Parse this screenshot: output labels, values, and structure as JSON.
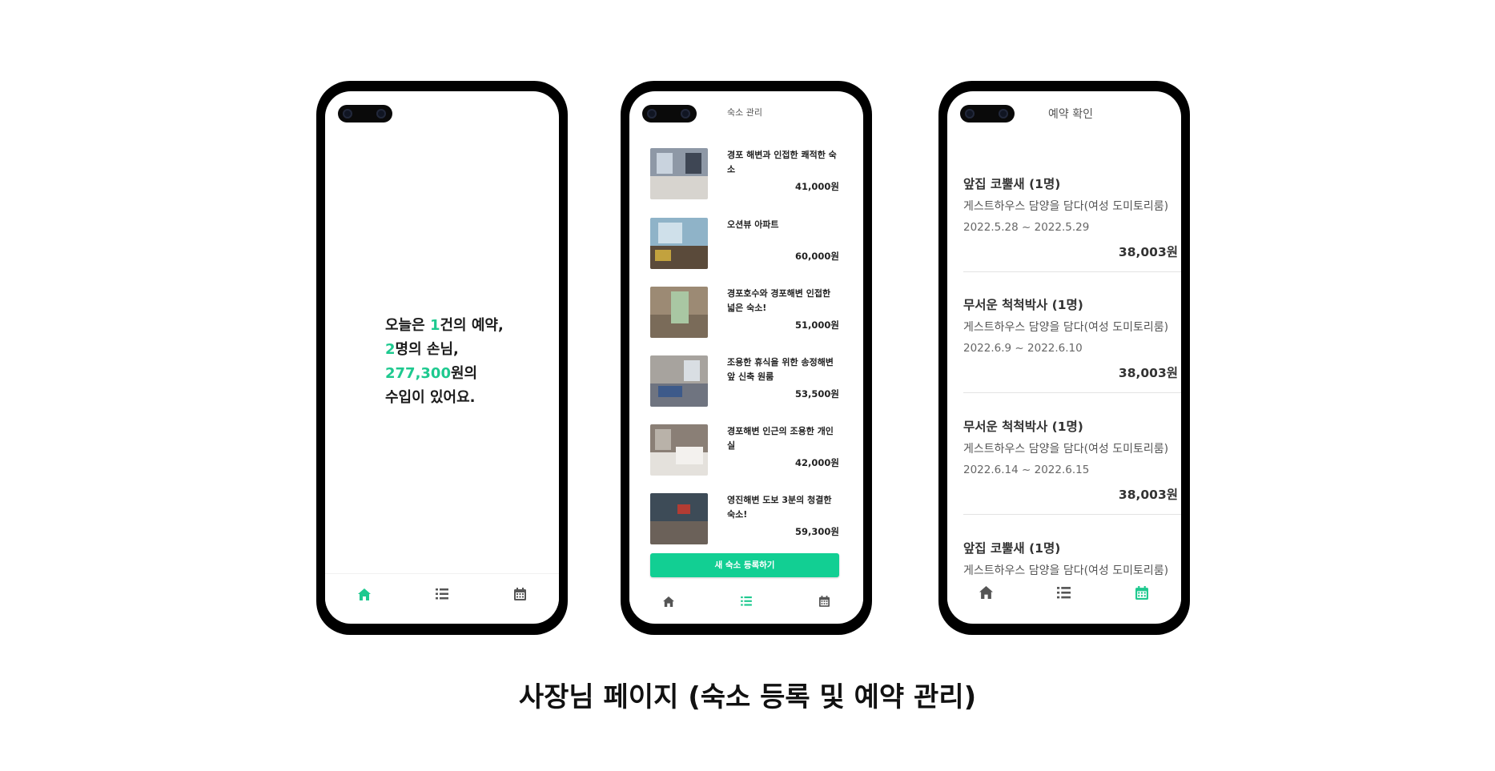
{
  "caption": "사장님 페이지 (숙소 등록 및 예약 관리)",
  "colors": {
    "accent": "#1ec98f",
    "button": "#12cf93",
    "nav_inactive": "#555555"
  },
  "home_screen": {
    "line1_prefix": "오늘은 ",
    "bookings_count": "1",
    "line1_suffix": "건의 예약,",
    "guests_count": "2",
    "line2_suffix": "명의 손님,",
    "income": "277,300",
    "line3_suffix": "원의",
    "line4": "수입이 있어요.",
    "nav": {
      "active": "home",
      "icons": [
        "home-icon",
        "list-icon",
        "calendar-icon"
      ]
    }
  },
  "listings_screen": {
    "title": "숙소 관리",
    "listings": [
      {
        "name": "경포 해변과 인접한 쾌적한 숙소",
        "price": "41,000원"
      },
      {
        "name": "오션뷰 아파트",
        "price": "60,000원"
      },
      {
        "name": "경포호수와 경포해변 인접한 넓은 숙소!",
        "price": "51,000원"
      },
      {
        "name": "조용한 휴식을 위한 송정해변 앞 신축 원룸",
        "price": "53,500원"
      },
      {
        "name": "경포해변 인근의 조용한 개인실",
        "price": "42,000원"
      },
      {
        "name": "영진해변 도보 3분의 청결한 숙소!",
        "price": "59,300원"
      }
    ],
    "register_button": "새 숙소 등록하기",
    "nav": {
      "active": "list",
      "icons": [
        "home-icon",
        "list-icon",
        "calendar-icon"
      ]
    }
  },
  "reservations_screen": {
    "title": "예약 확인",
    "reservations": [
      {
        "guest": "앞집 코뿔새 (1명)",
        "place": "게스트하우스 담양을 담다(여성 도미토리룸)",
        "dates": "2022.5.28 ~ 2022.5.29",
        "amount": "38,003원"
      },
      {
        "guest": "무서운 척척박사 (1명)",
        "place": "게스트하우스 담양을 담다(여성 도미토리룸)",
        "dates": "2022.6.9 ~ 2022.6.10",
        "amount": "38,003원"
      },
      {
        "guest": "무서운 척척박사 (1명)",
        "place": "게스트하우스 담양을 담다(여성 도미토리룸)",
        "dates": "2022.6.14 ~ 2022.6.15",
        "amount": "38,003원"
      },
      {
        "guest": "앞집 코뿔새 (1명)",
        "place": "게스트하우스 담양을 담다(여성 도미토리룸)",
        "dates": "",
        "amount": ""
      }
    ],
    "nav": {
      "active": "calendar",
      "icons": [
        "home-icon",
        "list-icon",
        "calendar-icon"
      ]
    }
  }
}
